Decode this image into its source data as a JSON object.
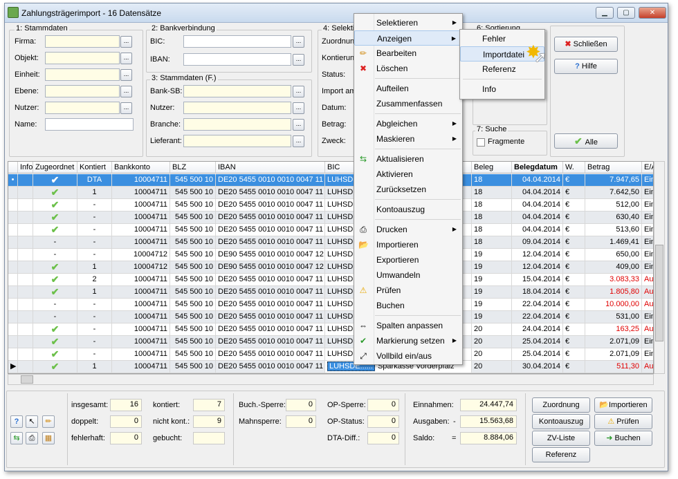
{
  "window": {
    "title": "Zahlungsträgerimport - 16 Datensätze",
    "min": "▁",
    "max": "▢",
    "close": "✕"
  },
  "g1": {
    "label": "1: Stammdaten",
    "fields": [
      "Firma:",
      "Objekt:",
      "Einheit:",
      "Ebene:",
      "Nutzer:",
      "Name:"
    ]
  },
  "g2": {
    "label": "2: Bankverbindung",
    "fields": [
      "BIC:",
      "IBAN:"
    ]
  },
  "g3": {
    "label": "3: Stammdaten (F.)",
    "fields": [
      "Bank-SB:",
      "Nutzer:",
      "Branche:",
      "Lieferant:"
    ]
  },
  "g4": {
    "label": "4: Selektio",
    "fields": [
      "Zuordnun",
      "Kontierun",
      "Status:",
      "Import am",
      "Datum:",
      "Betrag:",
      "Zweck:"
    ]
  },
  "g6": {
    "label": "6: Sortierung"
  },
  "g7": {
    "label": "7: Suche",
    "check": "Fragmente"
  },
  "buttons": {
    "close": "Schließen",
    "help": "Hilfe",
    "all": "Alle",
    "dots": "..."
  },
  "columns": [
    "Info",
    "Zugeordnet",
    "Kontiert",
    "Bankkonto",
    "BLZ",
    "IBAN",
    "BIC",
    "",
    "Beleg",
    "Belegdatum",
    "W.",
    "Betrag",
    "E/A"
  ],
  "rows": [
    {
      "ind": "•",
      "z": "✔",
      "k": "DTA",
      "bank": "10004711",
      "blz": "545 500 10",
      "iban": "DE20 5455 0010 0010 0047 11",
      "bic": "LUHSDE",
      "beleg": "18",
      "date": "04.04.2014",
      "w": "€",
      "betrag": "7.947,65",
      "ea": "Ein",
      "red": false,
      "sel": true
    },
    {
      "ind": "",
      "z": "✔",
      "k": "1",
      "bank": "10004711",
      "blz": "545 500 10",
      "iban": "DE20 5455 0010 0010 0047 11",
      "bic": "LUHSDE",
      "beleg": "18",
      "date": "04.04.2014",
      "w": "€",
      "betrag": "7.642,50",
      "ea": "Ein",
      "red": false
    },
    {
      "ind": "",
      "z": "✔",
      "k": "-",
      "bank": "10004711",
      "blz": "545 500 10",
      "iban": "DE20 5455 0010 0010 0047 11",
      "bic": "LUHSDE",
      "beleg": "18",
      "date": "04.04.2014",
      "w": "€",
      "betrag": "512,00",
      "ea": "Ein",
      "red": false
    },
    {
      "ind": "",
      "z": "✔",
      "k": "-",
      "bank": "10004711",
      "blz": "545 500 10",
      "iban": "DE20 5455 0010 0010 0047 11",
      "bic": "LUHSDE",
      "beleg": "18",
      "date": "04.04.2014",
      "w": "€",
      "betrag": "630,40",
      "ea": "Ein",
      "red": false
    },
    {
      "ind": "",
      "z": "✔",
      "k": "-",
      "bank": "10004711",
      "blz": "545 500 10",
      "iban": "DE20 5455 0010 0010 0047 11",
      "bic": "LUHSDE",
      "beleg": "18",
      "date": "04.04.2014",
      "w": "€",
      "betrag": "513,60",
      "ea": "Ein",
      "red": false
    },
    {
      "ind": "",
      "z": "-",
      "k": "-",
      "bank": "10004711",
      "blz": "545 500 10",
      "iban": "DE20 5455 0010 0010 0047 11",
      "bic": "LUHSDE",
      "beleg": "18",
      "date": "09.04.2014",
      "w": "€",
      "betrag": "1.469,41",
      "ea": "Ein",
      "red": false
    },
    {
      "ind": "",
      "z": "-",
      "k": "-",
      "bank": "10004712",
      "blz": "545 500 10",
      "iban": "DE90 5455 0010 0010 0047 12",
      "bic": "LUHSDE",
      "beleg": "19",
      "date": "12.04.2014",
      "w": "€",
      "betrag": "650,00",
      "ea": "Ein",
      "red": false
    },
    {
      "ind": "",
      "z": "✔",
      "k": "1",
      "bank": "10004712",
      "blz": "545 500 10",
      "iban": "DE90 5455 0010 0010 0047 12",
      "bic": "LUHSDE",
      "beleg": "19",
      "date": "12.04.2014",
      "w": "€",
      "betrag": "409,00",
      "ea": "Ein",
      "red": false
    },
    {
      "ind": "",
      "z": "✔",
      "k": "2",
      "bank": "10004711",
      "blz": "545 500 10",
      "iban": "DE20 5455 0010 0010 0047 11",
      "bic": "LUHSDE",
      "beleg": "19",
      "date": "15.04.2014",
      "w": "€",
      "betrag": "3.083,33",
      "ea": "Au",
      "red": true
    },
    {
      "ind": "",
      "z": "✔",
      "k": "1",
      "bank": "10004711",
      "blz": "545 500 10",
      "iban": "DE20 5455 0010 0010 0047 11",
      "bic": "LUHSDE",
      "beleg": "19",
      "date": "18.04.2014",
      "w": "€",
      "betrag": "1.805,80",
      "ea": "Au",
      "red": true
    },
    {
      "ind": "",
      "z": "-",
      "k": "-",
      "bank": "10004711",
      "blz": "545 500 10",
      "iban": "DE20 5455 0010 0010 0047 11",
      "bic": "LUHSDE",
      "beleg": "19",
      "date": "22.04.2014",
      "w": "€",
      "betrag": "10.000,00",
      "ea": "Au",
      "red": true
    },
    {
      "ind": "",
      "z": "-",
      "k": "-",
      "bank": "10004711",
      "blz": "545 500 10",
      "iban": "DE20 5455 0010 0010 0047 11",
      "bic": "LUHSDE",
      "beleg": "19",
      "date": "22.04.2014",
      "w": "€",
      "betrag": "531,00",
      "ea": "Ein",
      "red": false
    },
    {
      "ind": "",
      "z": "✔",
      "k": "-",
      "bank": "10004711",
      "blz": "545 500 10",
      "iban": "DE20 5455 0010 0010 0047 11",
      "bic": "LUHSDE",
      "beleg": "20",
      "date": "24.04.2014",
      "w": "€",
      "betrag": "163,25",
      "ea": "Au",
      "red": true
    },
    {
      "ind": "",
      "z": "✔",
      "k": "-",
      "bank": "10004711",
      "blz": "545 500 10",
      "iban": "DE20 5455 0010 0010 0047 11",
      "bic": "LUHSDE",
      "beleg": "20",
      "date": "25.04.2014",
      "w": "€",
      "betrag": "2.071,09",
      "ea": "Ein",
      "red": false
    },
    {
      "ind": "",
      "z": "✔",
      "k": "-",
      "bank": "10004711",
      "blz": "545 500 10",
      "iban": "DE20 5455 0010 0010 0047 11",
      "bic": "LUHSDE",
      "beleg": "20",
      "date": "25.04.2014",
      "w": "€",
      "betrag": "2.071,09",
      "ea": "Ein",
      "red": false
    },
    {
      "ind": "▶",
      "z": "✔",
      "k": "1",
      "bank": "10004711",
      "blz": "545 500 10",
      "iban": "DE20 5455 0010 0010 0047 11",
      "bic": "LUHSDE......",
      "extra": "Sparkasse Vorderpfalz",
      "beleg": "20",
      "date": "30.04.2014",
      "w": "€",
      "betrag": "511,30",
      "ea": "Au",
      "red": true
    }
  ],
  "stats": {
    "insgesamt": "insgesamt:",
    "insgesamt_v": "16",
    "doppelt": "doppelt:",
    "doppelt_v": "0",
    "fehlerhaft": "fehlerhaft:",
    "fehlerhaft_v": "0",
    "kontiert": "kontiert:",
    "kontiert_v": "7",
    "nichtkont": "nicht kont.:",
    "nichtkont_v": "9",
    "gebucht": "gebucht:",
    "gebucht_v": "",
    "buchsperre": "Buch.-Sperre:",
    "buchsperre_v": "0",
    "mahnsperre": "Mahnsperre:",
    "mahnsperre_v": "0",
    "opsperre": "OP-Sperre:",
    "opsperre_v": "0",
    "opstatus": "OP-Status:",
    "opstatus_v": "0",
    "dtadiff": "DTA-Diff.:",
    "dtadiff_v": "0",
    "einnahmen": "Einnahmen:",
    "einnahmen_v": "24.447,74",
    "ausgaben": "Ausgaben:",
    "ausgaben_sign": "-",
    "ausgaben_v": "15.563,68",
    "saldo": "Saldo:",
    "saldo_sign": "=",
    "saldo_v": "8.884,06"
  },
  "bottom_buttons": {
    "zuordnung": "Zuordnung",
    "importieren": "Importieren",
    "kontoauszug": "Kontoauszug",
    "pruefen": "Prüfen",
    "zvliste": "ZV-Liste",
    "buchen": "Buchen",
    "referenz": "Referenz"
  },
  "menu": [
    {
      "label": "Selektieren",
      "sub": true,
      "icon": ""
    },
    {
      "label": "Anzeigen",
      "sub": true,
      "icon": "",
      "hl": true
    },
    {
      "label": "Bearbeiten",
      "icon": "✏"
    },
    {
      "label": "Löschen",
      "icon": "✖"
    },
    {
      "sep": true
    },
    {
      "label": "Aufteilen",
      "icon": ""
    },
    {
      "label": "Zusammenfassen",
      "icon": ""
    },
    {
      "sep": true
    },
    {
      "label": "Abgleichen",
      "sub": true,
      "icon": ""
    },
    {
      "label": "Maskieren",
      "sub": true,
      "icon": ""
    },
    {
      "sep": true
    },
    {
      "label": "Aktualisieren",
      "icon": "⇆"
    },
    {
      "label": "Aktivieren",
      "icon": ""
    },
    {
      "label": "Zurücksetzen",
      "icon": ""
    },
    {
      "sep": true
    },
    {
      "label": "Kontoauszug",
      "icon": ""
    },
    {
      "sep": true
    },
    {
      "label": "Drucken",
      "sub": true,
      "icon": "⎙"
    },
    {
      "label": "Importieren",
      "icon": "📂"
    },
    {
      "label": "Exportieren",
      "icon": ""
    },
    {
      "label": "Umwandeln",
      "icon": ""
    },
    {
      "label": "Prüfen",
      "icon": "⚠"
    },
    {
      "label": "Buchen",
      "icon": ""
    },
    {
      "sep": true
    },
    {
      "label": "Spalten anpassen",
      "icon": "⇔"
    },
    {
      "label": "Markierung setzen",
      "sub": true,
      "icon": "✔"
    },
    {
      "label": "Vollbild ein/aus",
      "icon": "⤢"
    }
  ],
  "submenu": [
    {
      "label": "Fehler"
    },
    {
      "label": "Importdatei",
      "hl": true
    },
    {
      "label": "Referenz"
    },
    {
      "sep": true
    },
    {
      "label": "Info"
    }
  ]
}
